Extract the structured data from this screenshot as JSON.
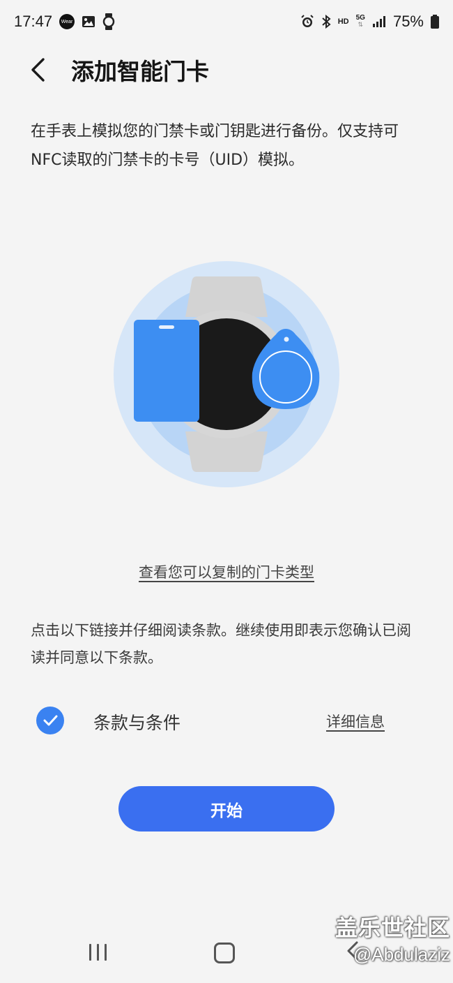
{
  "status_bar": {
    "time": "17:47",
    "wear_badge": "Wear",
    "network": "5G",
    "hd": "HD",
    "battery_percent": "75%",
    "left_icons": [
      "wear-icon",
      "gallery-icon",
      "watch-icon"
    ],
    "right_icons": [
      "alarm-icon",
      "bluetooth-icon",
      "hd-icon",
      "5g-icon",
      "signal-icon",
      "battery-icon"
    ]
  },
  "header": {
    "title": "添加智能门卡"
  },
  "description": "在手表上模拟您的门禁卡或门钥匙进行备份。仅支持可NFC读取的门禁卡的卡号（UID）模拟。",
  "link_card_types": "查看您可以复制的门卡类型",
  "terms": {
    "text": "点击以下链接并仔细阅读条款。继续使用即表示您确认已阅读并同意以下条款。",
    "checkbox_label": "条款与条件",
    "checked": true,
    "details_link": "详细信息"
  },
  "start_button": "开始",
  "watermark": {
    "brand": "盖乐世社区",
    "user": "@Abdulaziz"
  },
  "colors": {
    "accent": "#3a6ff0",
    "check": "#3a82f1",
    "card_blue": "#3d8ef2",
    "halo_outer": "#d6e6f8",
    "halo_inner": "#b8d5f6",
    "background": "#f4f4f4"
  }
}
